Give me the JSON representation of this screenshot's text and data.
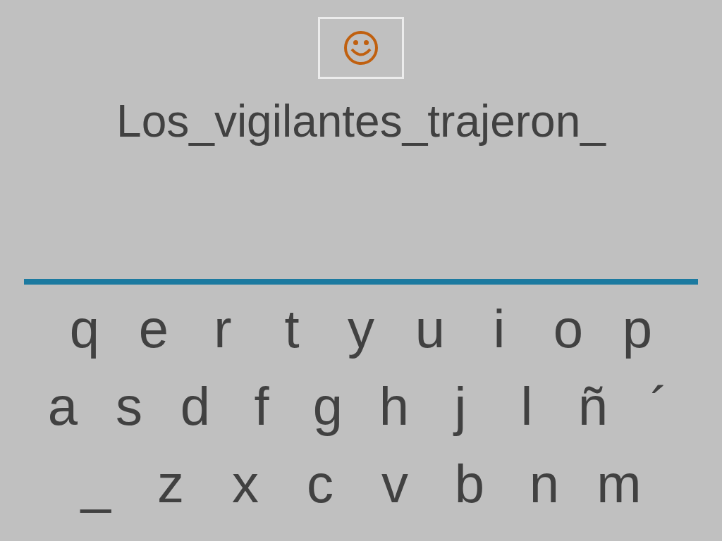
{
  "sentence": "Los_vigilantes_trajeron_",
  "keyboard": [
    [
      "q",
      "e",
      "r",
      "t",
      "y",
      "u",
      "i",
      "o",
      "p"
    ],
    [
      "a",
      "s",
      "d",
      "f",
      "g",
      "h",
      "j",
      "l",
      "ñ",
      "´"
    ],
    [
      "_",
      "z",
      "x",
      "c",
      "v",
      "b",
      "n",
      "m"
    ]
  ]
}
